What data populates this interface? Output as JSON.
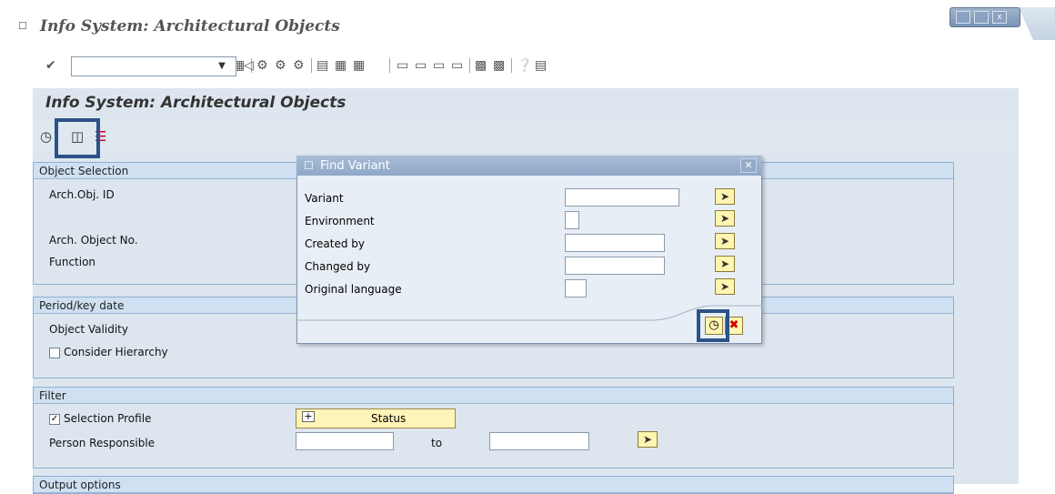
{
  "window": {
    "title": "Info System: Architectural Objects",
    "title_icon": "exit-icon"
  },
  "toolbar": {
    "command_field_value": "",
    "icons": [
      "enter-icon",
      "save-icon",
      "back-icon",
      "exit-icon",
      "cancel-icon",
      "print-icon",
      "find-icon",
      "find-next-icon",
      "first-page-icon",
      "previous-page-icon",
      "next-page-icon",
      "last-page-icon",
      "create-session-icon",
      "shortcut-icon",
      "help-icon",
      "customize-layout-icon"
    ]
  },
  "screen": {
    "title": "Info System: Architectural Objects",
    "app_toolbar": [
      "execute-icon",
      "get-variant-icon",
      "dynamic-selections-icon"
    ]
  },
  "groups": {
    "object_selection": {
      "title": "Object Selection",
      "fields": [
        "Arch.Obj. ID",
        "Arch. Object No.",
        "Function"
      ]
    },
    "period": {
      "title": "Period/key date",
      "object_validity": "Object Validity",
      "consider_hierarchy": "Consider Hierarchy",
      "consider_hierarchy_checked": false
    },
    "filter": {
      "title": "Filter",
      "selection_profile": "Selection Profile",
      "selection_profile_checked": true,
      "status_button": "Status",
      "person_responsible": "Person Responsible",
      "to_label": "to"
    },
    "output": {
      "title": "Output options"
    }
  },
  "dialog": {
    "title": "Find Variant",
    "fields": [
      {
        "label": "Variant",
        "value": ""
      },
      {
        "label": "Environment",
        "value": ""
      },
      {
        "label": "Created by",
        "value": ""
      },
      {
        "label": "Changed by",
        "value": ""
      },
      {
        "label": "Original language",
        "value": ""
      }
    ]
  },
  "colors": {
    "screen_bg": "#dde6ef",
    "highlight": "#2b5289",
    "button_yellow": "#fff5b0"
  }
}
